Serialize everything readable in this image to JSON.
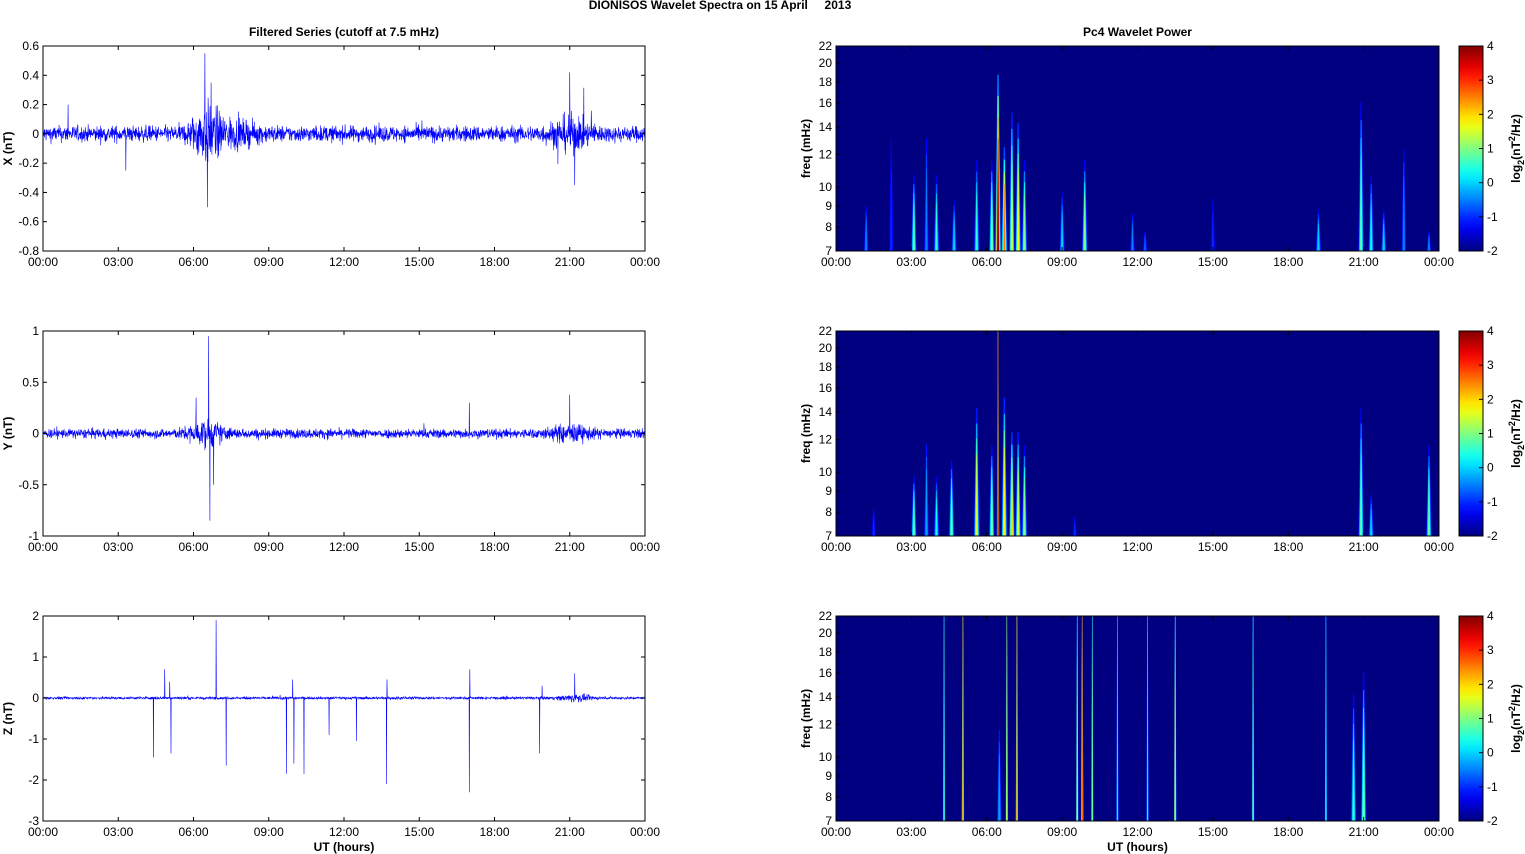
{
  "figure_title": "DIONISOS Wavelet Spectra on 15 April     2013",
  "chart_data": [
    {
      "type": "line",
      "panel": "X",
      "title": "Filtered Series (cutoff at 7.5 mHz)",
      "ylabel": "X (nT)",
      "xlabel": "",
      "ylim": [
        -0.8,
        0.6
      ],
      "yticks": [
        "-0.8",
        "-0.6",
        "-0.4",
        "-0.2",
        "0",
        "0.2",
        "0.4",
        "0.6"
      ],
      "ytick_values": [
        -0.8,
        -0.6,
        -0.4,
        -0.2,
        0,
        0.2,
        0.4,
        0.6
      ],
      "xticks": [
        "00:00",
        "03:00",
        "06:00",
        "09:00",
        "12:00",
        "15:00",
        "18:00",
        "21:00",
        "00:00"
      ],
      "xlim_hours": [
        0,
        24
      ],
      "noise_amplitude": 0.07,
      "activity": [
        [
          6.5,
          0.18,
          0.6
        ],
        [
          21,
          0.1,
          0.8
        ],
        [
          7.5,
          0.07,
          1.0
        ]
      ],
      "spikes": [
        [
          6.45,
          0.55
        ],
        [
          6.55,
          -0.5
        ],
        [
          6.7,
          0.35
        ],
        [
          21.0,
          0.42
        ],
        [
          21.2,
          -0.35
        ],
        [
          3.3,
          -0.25
        ],
        [
          1.0,
          0.2
        ]
      ],
      "color": "#0000ff"
    },
    {
      "type": "line",
      "panel": "Y",
      "title": "",
      "ylabel": "Y (nT)",
      "xlabel": "",
      "ylim": [
        -1,
        1
      ],
      "yticks": [
        "-1",
        "-0.5",
        "0",
        "0.5",
        "1"
      ],
      "ytick_values": [
        -1,
        -0.5,
        0,
        0.5,
        1
      ],
      "xticks": [
        "00:00",
        "03:00",
        "06:00",
        "09:00",
        "12:00",
        "15:00",
        "18:00",
        "21:00",
        "00:00"
      ],
      "xlim_hours": [
        0,
        24
      ],
      "noise_amplitude": 0.06,
      "activity": [
        [
          6.5,
          0.12,
          0.7
        ],
        [
          21,
          0.07,
          0.8
        ]
      ],
      "spikes": [
        [
          6.6,
          0.95
        ],
        [
          6.65,
          -0.85
        ],
        [
          6.1,
          0.35
        ],
        [
          6.8,
          -0.5
        ],
        [
          21.0,
          0.38
        ],
        [
          17.0,
          0.3
        ],
        [
          24,
          0.4
        ]
      ],
      "color": "#0000ff"
    },
    {
      "type": "line",
      "panel": "Z",
      "title": "",
      "ylabel": "Z (nT)",
      "xlabel": "UT (hours)",
      "ylim": [
        -3,
        2
      ],
      "yticks": [
        "-3",
        "-2",
        "-1",
        "0",
        "1",
        "2"
      ],
      "ytick_values": [
        -3,
        -2,
        -1,
        0,
        1,
        2
      ],
      "xticks": [
        "00:00",
        "03:00",
        "06:00",
        "09:00",
        "12:00",
        "15:00",
        "18:00",
        "21:00",
        "00:00"
      ],
      "xlim_hours": [
        0,
        24
      ],
      "noise_amplitude": 0.04,
      "activity": [
        [
          21.2,
          0.1,
          0.6
        ]
      ],
      "spikes": [
        [
          4.4,
          -1.45
        ],
        [
          4.85,
          0.7
        ],
        [
          5.1,
          -1.35
        ],
        [
          5.05,
          0.4
        ],
        [
          6.9,
          1.9
        ],
        [
          7.3,
          -1.65
        ],
        [
          9.7,
          -1.85
        ],
        [
          9.95,
          0.45
        ],
        [
          10.0,
          -1.6
        ],
        [
          10.4,
          -1.85
        ],
        [
          11.4,
          -0.9
        ],
        [
          12.5,
          -1.05
        ],
        [
          13.7,
          -2.1
        ],
        [
          13.72,
          0.45
        ],
        [
          17.0,
          -2.3
        ],
        [
          17.02,
          0.7
        ],
        [
          19.8,
          -1.35
        ],
        [
          19.9,
          0.3
        ],
        [
          21.2,
          0.6
        ]
      ],
      "color": "#0000ff"
    },
    {
      "type": "heatmap",
      "panel": "X",
      "title": "Pc4 Wavelet Power",
      "ylabel": "freq (mHz)",
      "xlabel": "",
      "yscale": "log",
      "ylim": [
        7,
        22
      ],
      "yticks": [
        "7",
        "8",
        "9",
        "10",
        "12",
        "14",
        "16",
        "18",
        "20",
        "22"
      ],
      "ytick_values": [
        7,
        8,
        9,
        10,
        12,
        14,
        16,
        18,
        20,
        22
      ],
      "xticks": [
        "00:00",
        "03:00",
        "06:00",
        "09:00",
        "12:00",
        "15:00",
        "18:00",
        "21:00",
        "00:00"
      ],
      "colorbar": {
        "label_parts": [
          "log",
          "2",
          "(nT",
          "2",
          "/Hz)"
        ],
        "range": [
          -2,
          4
        ],
        "ticks": [
          "-2",
          "-1",
          "0",
          "1",
          "2",
          "3",
          "4"
        ],
        "colormap": "jet"
      },
      "events": [
        [
          1.2,
          9.5,
          -0.5
        ],
        [
          2.2,
          15,
          -1
        ],
        [
          3.1,
          11,
          0.8
        ],
        [
          3.6,
          15,
          -0.5
        ],
        [
          4.0,
          11,
          0.5
        ],
        [
          4.7,
          9.5,
          0
        ],
        [
          5.6,
          12,
          0.5
        ],
        [
          6.2,
          12,
          1
        ],
        [
          6.45,
          20,
          3.8
        ],
        [
          6.7,
          13,
          2.5
        ],
        [
          7.0,
          16,
          1.5
        ],
        [
          7.25,
          15,
          1.8
        ],
        [
          7.5,
          12,
          1
        ],
        [
          9.0,
          10,
          0
        ],
        [
          9.9,
          12,
          1
        ],
        [
          11.8,
          9,
          -0.5
        ],
        [
          12.3,
          8,
          -0.7
        ],
        [
          15.0,
          10,
          -1
        ],
        [
          19.2,
          9,
          0
        ],
        [
          20.9,
          17,
          0.8
        ],
        [
          21.3,
          11,
          0.3
        ],
        [
          21.8,
          9,
          0
        ],
        [
          22.6,
          14,
          -0.5
        ],
        [
          23.6,
          8,
          -0.5
        ]
      ]
    },
    {
      "type": "heatmap",
      "panel": "Y",
      "title": "",
      "ylabel": "freq (mHz)",
      "xlabel": "",
      "yscale": "log",
      "ylim": [
        7,
        22
      ],
      "yticks": [
        "7",
        "8",
        "9",
        "10",
        "12",
        "14",
        "16",
        "18",
        "20",
        "22"
      ],
      "ytick_values": [
        7,
        8,
        9,
        10,
        12,
        14,
        16,
        18,
        20,
        22
      ],
      "xticks": [
        "00:00",
        "03:00",
        "06:00",
        "09:00",
        "12:00",
        "15:00",
        "18:00",
        "21:00",
        "00:00"
      ],
      "colorbar": {
        "label_parts": [
          "log",
          "2",
          "(nT",
          "2",
          "/Hz)"
        ],
        "range": [
          -2,
          4
        ],
        "ticks": [
          "-2",
          "-1",
          "0",
          "1",
          "2",
          "3",
          "4"
        ],
        "colormap": "jet"
      },
      "events": [
        [
          1.5,
          8.5,
          -1
        ],
        [
          3.1,
          10,
          0.8
        ],
        [
          3.6,
          13,
          -0.3
        ],
        [
          4.0,
          10,
          0.3
        ],
        [
          4.6,
          11,
          0.8
        ],
        [
          5.6,
          15,
          1.5
        ],
        [
          6.2,
          12,
          1
        ],
        [
          6.45,
          22,
          3.8
        ],
        [
          6.7,
          16,
          1.8
        ],
        [
          7.0,
          13,
          2
        ],
        [
          7.25,
          13,
          1.5
        ],
        [
          7.5,
          12,
          1
        ],
        [
          9.5,
          8,
          -1
        ],
        [
          20.9,
          15,
          0.8
        ],
        [
          21.3,
          9,
          0
        ],
        [
          23.6,
          12,
          0.8
        ]
      ]
    },
    {
      "type": "heatmap",
      "panel": "Z",
      "title": "",
      "ylabel": "freq (mHz)",
      "xlabel": "UT (hours)",
      "yscale": "log",
      "ylim": [
        7,
        22
      ],
      "yticks": [
        "7",
        "8",
        "9",
        "10",
        "12",
        "14",
        "16",
        "18",
        "20",
        "22"
      ],
      "ytick_values": [
        7,
        8,
        9,
        10,
        12,
        14,
        16,
        18,
        20,
        22
      ],
      "xticks": [
        "00:00",
        "03:00",
        "06:00",
        "09:00",
        "12:00",
        "15:00",
        "18:00",
        "21:00",
        "00:00"
      ],
      "colorbar": {
        "label_parts": [
          "log",
          "2",
          "(nT",
          "2",
          "/Hz)"
        ],
        "range": [
          -2,
          4
        ],
        "ticks": [
          "-2",
          "-1",
          "0",
          "1",
          "2",
          "3",
          "4"
        ],
        "colormap": "jet"
      },
      "events": [
        [
          4.3,
          22,
          0.8
        ],
        [
          5.05,
          22,
          2.5
        ],
        [
          6.5,
          13,
          -0.3
        ],
        [
          6.8,
          22,
          1.5
        ],
        [
          7.2,
          22,
          2.5
        ],
        [
          9.6,
          22,
          1.5
        ],
        [
          9.8,
          22,
          3
        ],
        [
          10.2,
          22,
          1
        ],
        [
          11.2,
          22,
          0.3
        ],
        [
          12.4,
          22,
          0.3
        ],
        [
          13.5,
          22,
          2
        ],
        [
          16.6,
          22,
          1
        ],
        [
          19.5,
          22,
          0.5
        ],
        [
          20.6,
          15,
          0.5
        ],
        [
          21.0,
          17,
          1
        ]
      ]
    }
  ]
}
